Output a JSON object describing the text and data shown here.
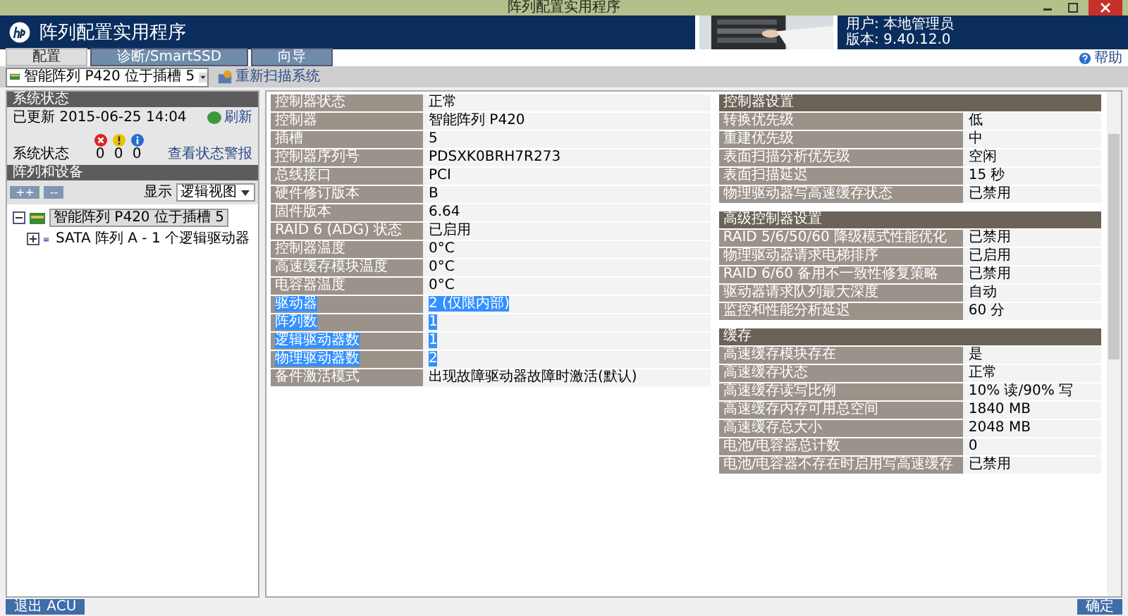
{
  "window": {
    "title": "阵列配置实用程序"
  },
  "header": {
    "app_name": "阵列配置实用程序",
    "user": "用户: 本地管理员",
    "version": "版本: 9.40.12.0",
    "help": "帮助"
  },
  "tabs": [
    {
      "label": "配置",
      "selected": true
    },
    {
      "label": "诊断/SmartSSD",
      "selected": false
    },
    {
      "label": "向导",
      "selected": false
    }
  ],
  "device_select": {
    "value": "智能阵列 P420 位于插槽 5"
  },
  "toolbar": {
    "rescan": "重新扫描系统"
  },
  "system_status": {
    "title": "系统状态",
    "updated": "已更新 2015-06-25 14:04",
    "refresh": "刷新",
    "label": "系统状态",
    "counts": [
      {
        "kind": "error",
        "count": "0"
      },
      {
        "kind": "warning",
        "count": "0"
      },
      {
        "kind": "info",
        "count": "0"
      }
    ],
    "link": "查看状态警报"
  },
  "arrays": {
    "title": "阵列和设备",
    "expand": "++",
    "collapse": "--",
    "show_label": "显示",
    "view": "逻辑视图",
    "tree": [
      {
        "label": "智能阵列 P420 位于插槽 5",
        "selected": true,
        "expanded": true,
        "children": [
          {
            "label": "SATA 阵列 A - 1 个逻辑驱动器",
            "selected": false,
            "expanded": false
          }
        ]
      }
    ]
  },
  "sections": [
    {
      "rows": [
        {
          "label": "控制器状态",
          "value": "正常",
          "highlighted": false
        },
        {
          "label": "控制器",
          "value": "智能阵列 P420",
          "highlighted": false
        },
        {
          "label": "插槽",
          "value": "5",
          "highlighted": false
        },
        {
          "label": "控制器序列号",
          "value": "PDSXK0BRH7R273",
          "highlighted": false
        },
        {
          "label": "总线接口",
          "value": "PCI",
          "highlighted": false
        },
        {
          "label": "硬件修订版本",
          "value": "B",
          "highlighted": false
        },
        {
          "label": "固件版本",
          "value": "6.64",
          "highlighted": false
        },
        {
          "label": "RAID 6 (ADG) 状态",
          "value": "已启用",
          "highlighted": false
        },
        {
          "label": "控制器温度",
          "value": "0°C",
          "highlighted": false
        },
        {
          "label": "高速缓存模块温度",
          "value": "0°C",
          "highlighted": false
        },
        {
          "label": "电容器温度",
          "value": "0°C",
          "highlighted": false
        },
        {
          "label": "驱动器",
          "value": "2 (仅限内部)",
          "highlighted": true
        },
        {
          "label": "阵列数",
          "value": "1",
          "highlighted": true
        },
        {
          "label": "逻辑驱动器数",
          "value": "1",
          "highlighted": true
        },
        {
          "label": "物理驱动器数",
          "value": "2",
          "highlighted": true
        },
        {
          "label": "备件激活模式",
          "value": "出现故障驱动器故障时激活(默认)",
          "highlighted": false
        }
      ]
    },
    {
      "title": "控制器设置",
      "rows": [
        {
          "label": "转换优先级",
          "value": "低",
          "highlighted": false
        },
        {
          "label": "重建优先级",
          "value": "中",
          "highlighted": false
        },
        {
          "label": "表面扫描分析优先级",
          "value": "空闲",
          "highlighted": false
        },
        {
          "label": "表面扫描延迟",
          "value": "15 秒",
          "highlighted": false
        },
        {
          "label": "物理驱动器写高速缓存状态",
          "value": "已禁用",
          "highlighted": false
        }
      ]
    },
    {
      "title": "高级控制器设置",
      "rows": [
        {
          "label": "RAID 5/6/50/60 降级模式性能优化",
          "value": "已禁用",
          "highlighted": false
        },
        {
          "label": "物理驱动器请求电梯排序",
          "value": "已启用",
          "highlighted": false
        },
        {
          "label": "RAID 6/60 备用不一致性修复策略",
          "value": "已禁用",
          "highlighted": false
        },
        {
          "label": "驱动器请求队列最大深度",
          "value": "自动",
          "highlighted": false
        },
        {
          "label": "监控和性能分析延迟",
          "value": "60 分",
          "highlighted": false
        }
      ]
    },
    {
      "title": "缓存",
      "rows": [
        {
          "label": "高速缓存模块存在",
          "value": "是",
          "highlighted": false
        },
        {
          "label": "高速缓存状态",
          "value": "正常",
          "highlighted": false
        },
        {
          "label": "高速缓存读写比例",
          "value": "10% 读/90% 写",
          "highlighted": false
        },
        {
          "label": "高速缓存内存可用总空间",
          "value": "1840 MB",
          "highlighted": false
        },
        {
          "label": "高速缓存总大小",
          "value": "2048 MB",
          "highlighted": false
        },
        {
          "label": "电池/电容器总计数",
          "value": "0",
          "highlighted": false
        },
        {
          "label": "电池/电容器不存在时启用写高速缓存",
          "value": "已禁用",
          "highlighted": false
        }
      ]
    }
  ],
  "footer": {
    "exit": "退出 ACU",
    "ok": "确定"
  }
}
